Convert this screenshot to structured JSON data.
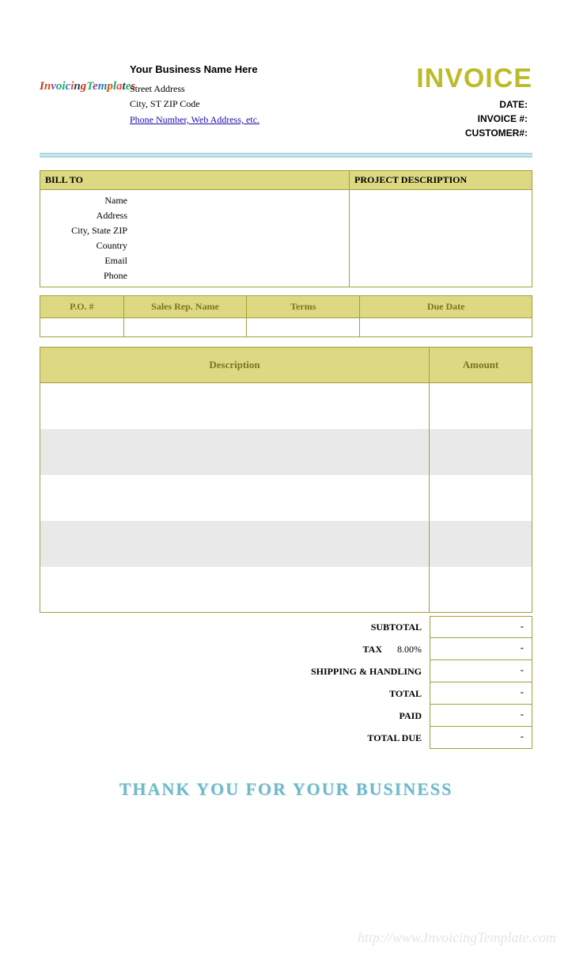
{
  "header": {
    "business_name": "Your Business Name Here",
    "street": "Street Address",
    "city_line": "City, ST  ZIP Code",
    "contact_link": "Phone Number, Web Address, etc.",
    "title": "INVOICE",
    "meta": {
      "date_label": "DATE:",
      "invoice_no_label": "INVOICE #:",
      "customer_no_label": "CUSTOMER#:"
    }
  },
  "billto": {
    "header": "BILL TO",
    "name": "Name",
    "address": "Address",
    "city": "City, State ZIP",
    "country": "Country",
    "email": "Email",
    "phone": "Phone"
  },
  "project": {
    "header": "PROJECT DESCRIPTION"
  },
  "po": {
    "po_no": "P.O. #",
    "sales_rep": "Sales Rep. Name",
    "terms": "Terms",
    "due_date": "Due Date"
  },
  "items": {
    "description_header": "Description",
    "amount_header": "Amount"
  },
  "totals": {
    "subtotal_label": "SUBTOTAL",
    "subtotal_value": "-",
    "tax_label": "TAX",
    "tax_rate": "8.00%",
    "tax_value": "-",
    "shipping_label": "SHIPPING & HANDLING",
    "shipping_value": "-",
    "total_label": "TOTAL",
    "total_value": "-",
    "paid_label": "PAID",
    "paid_value": "-",
    "due_label": "TOTAL DUE",
    "due_value": "-"
  },
  "footer": {
    "thankyou": "THANK YOU FOR YOUR BUSINESS",
    "watermark": "http://www.InvoicingTemplate.com"
  }
}
